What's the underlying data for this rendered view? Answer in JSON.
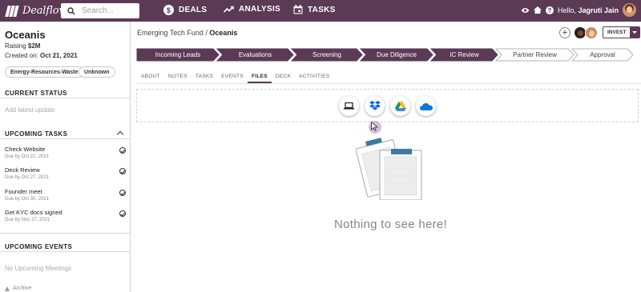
{
  "app": {
    "logo_text": "Dealflow",
    "search_placeholder": "Search...",
    "nav": [
      {
        "label": "DEALS"
      },
      {
        "label": "ANALYSIS"
      },
      {
        "label": "TASKS"
      }
    ],
    "greeting": "Hello, ",
    "user_name": "Jagruti Jain",
    "brand_color": "#5b3a56"
  },
  "company": {
    "name": "Oceanis",
    "raising_prefix": "Raising ",
    "raising_amount": "$2M",
    "created_prefix": "Created on: ",
    "created_date": "Oct 21, 2021",
    "tags": [
      "Energy-Resources-Waste",
      "Unknown"
    ]
  },
  "current_status": {
    "title": "CURRENT STATUS",
    "placeholder": "Add latest update"
  },
  "upcoming_tasks": {
    "title": "UPCOMING TASKS",
    "items": [
      {
        "title": "Check Website",
        "due": "Due by Oct 22, 2021"
      },
      {
        "title": "Deck Review",
        "due": "Due by Oct 27, 2021"
      },
      {
        "title": "Founder meet",
        "due": "Due by Oct 30, 2021"
      },
      {
        "title": "Get KYC docs signed",
        "due": "Due by Nov 27, 2021"
      }
    ]
  },
  "upcoming_events": {
    "title": "UPCOMING EVENTS",
    "empty_text": "No Upcoming Meetings"
  },
  "archive_label": "Archive",
  "breadcrumb": {
    "fund": "Emerging Tech Fund",
    "separator": " / ",
    "company": "Oceanis"
  },
  "invest_label": "INVEST",
  "pipeline": [
    {
      "label": "Incoming Leads",
      "completed": true
    },
    {
      "label": "Evaluations",
      "completed": true
    },
    {
      "label": "Screening",
      "completed": true
    },
    {
      "label": "Due Diligence",
      "completed": true
    },
    {
      "label": "IC Review",
      "completed": true
    },
    {
      "label": "Partner Review",
      "completed": false
    },
    {
      "label": "Approval",
      "completed": false
    }
  ],
  "tabs": [
    "ABOUT",
    "NOTES",
    "TASKS",
    "EVENTS",
    "FILES",
    "DECK",
    "ACTIVITIES"
  ],
  "active_tab": "FILES",
  "file_sources": [
    "laptop-icon",
    "dropbox-icon",
    "google-drive-icon",
    "onedrive-icon"
  ],
  "empty_state": "Nothing to see here!"
}
